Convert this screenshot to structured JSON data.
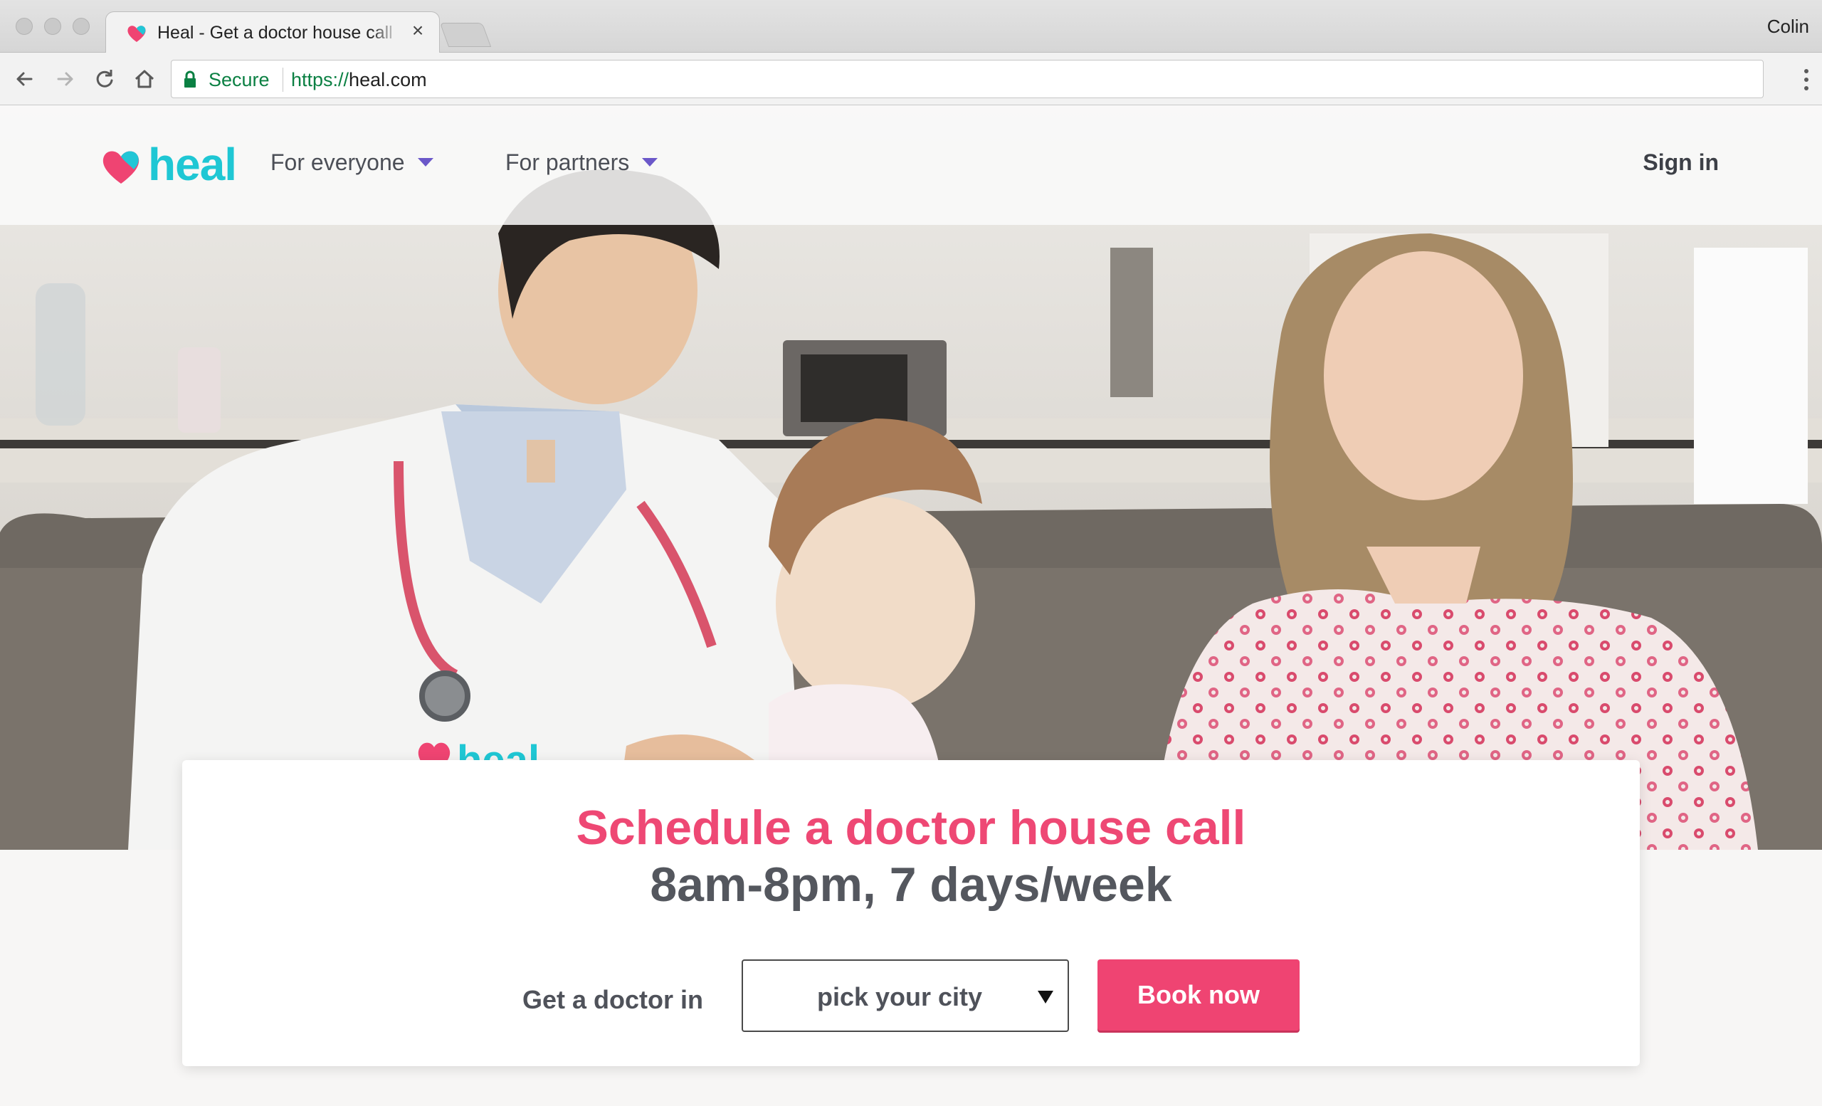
{
  "browser": {
    "tab_title": "Heal - Get a doctor house call",
    "tab_close": "×",
    "profile_name": "Colin",
    "secure_label": "Secure",
    "url_scheme": "https://",
    "url_host": "heal.com"
  },
  "nav": {
    "logo_text": "heal",
    "items": [
      {
        "label": "For everyone"
      },
      {
        "label": "For partners"
      }
    ],
    "sign_in": "Sign in"
  },
  "hero": {
    "badge_text": "heal"
  },
  "booking": {
    "headline": "Schedule a doctor house call",
    "subline": "8am-8pm, 7 days/week",
    "prompt": "Get a doctor in",
    "city_select": "pick your city",
    "book_button": "Book now"
  },
  "colors": {
    "brand_pink": "#ef4472",
    "brand_teal": "#1fc7d4",
    "accent_purple": "#6b58c9",
    "text_dark": "#54575e"
  }
}
